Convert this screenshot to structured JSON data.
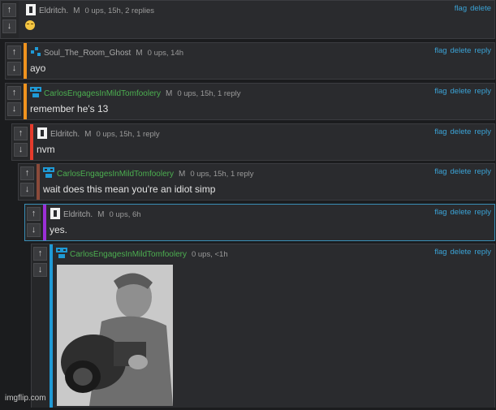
{
  "vote_up_label": "↑",
  "vote_down_label": "↓",
  "actions": {
    "flag": "flag",
    "delete": "delete",
    "reply": "reply"
  },
  "colors": {
    "orange_bar": "#f0931e",
    "red_bar": "#e53b2c",
    "brown_bar": "#8a4a3a",
    "purple_bar": "#9b2fd6",
    "blue_bar": "#1f9ad6",
    "green_user": "#4caf50",
    "blue_link": "#3ba3d6"
  },
  "comments": [
    {
      "user": "Eldritch.",
      "user_color": "#a8a8a8",
      "flag": "M",
      "meta": "0 ups, 15h, 2 replies",
      "text": "",
      "emoji": "smirk-emoji",
      "show_reply": false,
      "avatar": "white-square-icon"
    },
    {
      "user": "Soul_The_Room_Ghost",
      "user_color": "#a8a8a8",
      "flag": "M",
      "meta": "0 ups, 14h",
      "text": "ayo",
      "show_reply": true,
      "avatar": "blue-pixel-icon"
    },
    {
      "user": "CarlosEngagesInMildTomfoolery",
      "user_color": "#4caf50",
      "flag": "M",
      "meta": "0 ups, 15h, 1 reply",
      "text": "remember he's 13",
      "show_reply": true,
      "avatar": "blue-pixel-icon"
    },
    {
      "user": "Eldritch.",
      "user_color": "#a8a8a8",
      "flag": "M",
      "meta": "0 ups, 15h, 1 reply",
      "text": "nvm",
      "show_reply": true,
      "avatar": "white-square-icon"
    },
    {
      "user": "CarlosEngagesInMildTomfoolery",
      "user_color": "#4caf50",
      "flag": "M",
      "meta": "0 ups, 15h, 1 reply",
      "text": "wait does this mean you're an idiot simp",
      "show_reply": true,
      "avatar": "blue-pixel-icon"
    },
    {
      "user": "Eldritch.",
      "user_color": "#a8a8a8",
      "flag": "M",
      "meta": "0 ups, 6h",
      "text": "yes.",
      "show_reply": true,
      "avatar": "white-square-icon"
    },
    {
      "user": "CarlosEngagesInMildTomfoolery",
      "user_color": "#4caf50",
      "flag": "",
      "meta": "0 ups, <1h",
      "text": "",
      "show_reply": true,
      "avatar": "blue-pixel-icon",
      "image": "photo-soldier-with-camera"
    }
  ],
  "watermark": "imgflip.com"
}
